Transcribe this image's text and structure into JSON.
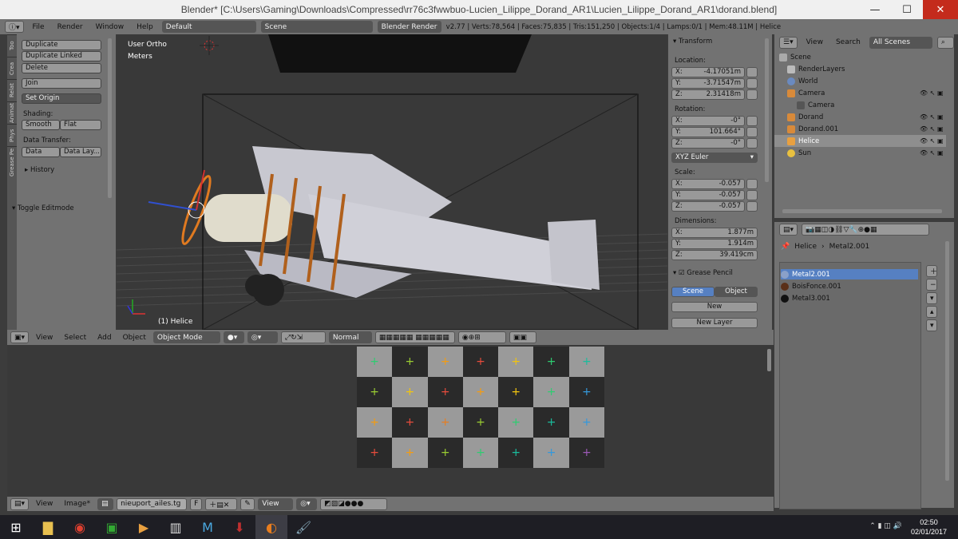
{
  "window": {
    "title": "Blender* [C:\\Users\\Gaming\\Downloads\\Compressed\\rr76c3fwwbuo-Lucien_Lilippe_Dorand_AR1\\Lucien_Lilippe_Dorand_AR1\\dorand.blend]",
    "minimize": "—",
    "maximize": "☐",
    "close": "✕"
  },
  "infobar": {
    "menus": [
      "File",
      "Render",
      "Window",
      "Help"
    ],
    "layout": "Default",
    "scene": "Scene",
    "engine": "Blender Render",
    "stats": "v2.77 | Verts:78,564 | Faces:75,835 | Tris:151,250 | Objects:1/4 | Lamps:0/1 | Mem:48.11M | Helice"
  },
  "toolshelf": {
    "tabs": [
      "Too",
      "Crea",
      "Relat",
      "Animat",
      "Phys",
      "Grease Pe"
    ],
    "duplicate": "Duplicate",
    "duplicate_linked": "Duplicate Linked",
    "delete": "Delete",
    "join": "Join",
    "set_origin": "Set Origin",
    "shading_label": "Shading:",
    "smooth": "Smooth",
    "flat": "Flat",
    "data_transfer_label": "Data Transfer:",
    "data": "Data",
    "data_lay": "Data Lay...",
    "history": "History",
    "toggle_editmode": "Toggle Editmode"
  },
  "viewport": {
    "view_name": "User Ortho",
    "units": "Meters",
    "object_label": "(1) Helice"
  },
  "transform": {
    "title": "Transform",
    "location_label": "Location:",
    "loc": [
      {
        "axis": "X:",
        "value": "-4.17051m"
      },
      {
        "axis": "Y:",
        "value": "-3.71547m"
      },
      {
        "axis": "Z:",
        "value": "2.31418m"
      }
    ],
    "rotation_label": "Rotation:",
    "rot": [
      {
        "axis": "X:",
        "value": "-0°"
      },
      {
        "axis": "Y:",
        "value": "101.664°"
      },
      {
        "axis": "Z:",
        "value": "-0°"
      }
    ],
    "rotation_mode": "XYZ Euler",
    "scale_label": "Scale:",
    "scale": [
      {
        "axis": "X:",
        "value": "-0.057"
      },
      {
        "axis": "Y:",
        "value": "-0.057"
      },
      {
        "axis": "Z:",
        "value": "-0.057"
      }
    ],
    "dimensions_label": "Dimensions:",
    "dim": [
      {
        "axis": "X:",
        "value": "1.877m"
      },
      {
        "axis": "Y:",
        "value": "1.914m"
      },
      {
        "axis": "Z:",
        "value": "39.419cm"
      }
    ],
    "grease_pencil": "Grease Pencil",
    "scene_btn": "Scene",
    "object_btn": "Object",
    "new_btn": "New",
    "new_layer": "New Layer"
  },
  "vp_header": {
    "view": "View",
    "select": "Select",
    "add": "Add",
    "object": "Object",
    "mode": "Object Mode",
    "pivot": "Normal"
  },
  "img_header": {
    "view": "View",
    "image": "Image*",
    "image_name": "nieuport_ailes.tg",
    "f": "F",
    "view2": "View"
  },
  "outliner": {
    "view": "View",
    "search": "Search",
    "filter": "All Scenes",
    "items": [
      {
        "name": "Scene",
        "indent": 0
      },
      {
        "name": "RenderLayers",
        "indent": 1
      },
      {
        "name": "World",
        "indent": 1
      },
      {
        "name": "Camera",
        "indent": 1
      },
      {
        "name": "Camera",
        "indent": 2
      },
      {
        "name": "Dorand",
        "indent": 1
      },
      {
        "name": "Dorand.001",
        "indent": 1
      },
      {
        "name": "Helice",
        "indent": 1
      },
      {
        "name": "Sun",
        "indent": 1
      }
    ]
  },
  "material": {
    "object": "Helice",
    "material": "Metal2.001",
    "slots": [
      {
        "name": "Metal2.001",
        "color": "#8aa0c8"
      },
      {
        "name": "BoisFonce.001",
        "color": "#5a3018"
      },
      {
        "name": "Metal3.001",
        "color": "#111111"
      }
    ]
  },
  "taskbar": {
    "time": "02:50",
    "date": "02/01/2017"
  },
  "checker_colors": [
    "#2ecc71",
    "#9acd32",
    "#f39c12",
    "#e74c3c",
    "#f1c40f",
    "#2ecc71",
    "#1abc9c",
    "#9acd32",
    "#f1c40f",
    "#e74c3c",
    "#f39c12",
    "#f1c40f",
    "#2ecc71",
    "#3498db",
    "#f39c12",
    "#e74c3c",
    "#e67e22",
    "#9acd32",
    "#2ecc71",
    "#1abc9c",
    "#3498db",
    "#e74c3c",
    "#f39c12",
    "#9acd32",
    "#2ecc71",
    "#1abc9c",
    "#3498db",
    "#9b59b6"
  ]
}
